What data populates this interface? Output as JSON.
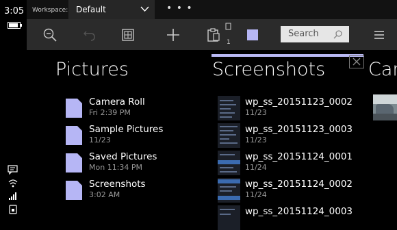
{
  "status": {
    "time": "3:05"
  },
  "workspace": {
    "label": "Workspace:",
    "value": "Default"
  },
  "toolbar": {
    "search_placeholder": "Search",
    "tab_count": "1"
  },
  "columns": {
    "pictures": {
      "title": "Pictures",
      "items": [
        {
          "name": "Camera Roll",
          "sub": "Fri 2:39 PM"
        },
        {
          "name": "Sample Pictures",
          "sub": "11/23"
        },
        {
          "name": "Saved Pictures",
          "sub": "Mon 11:34 PM"
        },
        {
          "name": "Screenshots",
          "sub": "3:02 AM"
        }
      ]
    },
    "screenshots": {
      "title": "Screenshots",
      "items": [
        {
          "name": "wp_ss_20151123_0002",
          "sub": "11/23"
        },
        {
          "name": "wp_ss_20151123_0003",
          "sub": "11/23"
        },
        {
          "name": "wp_ss_20151124_0001",
          "sub": "11/24"
        },
        {
          "name": "wp_ss_20151124_0002",
          "sub": "11/24"
        },
        {
          "name": "wp_ss_20151124_0003",
          "sub": ""
        }
      ]
    },
    "third": {
      "title": "Car"
    }
  },
  "colors": {
    "accent": "#b6b6f5",
    "toolbar": "#2b2b2b",
    "topbar": "#121212"
  }
}
